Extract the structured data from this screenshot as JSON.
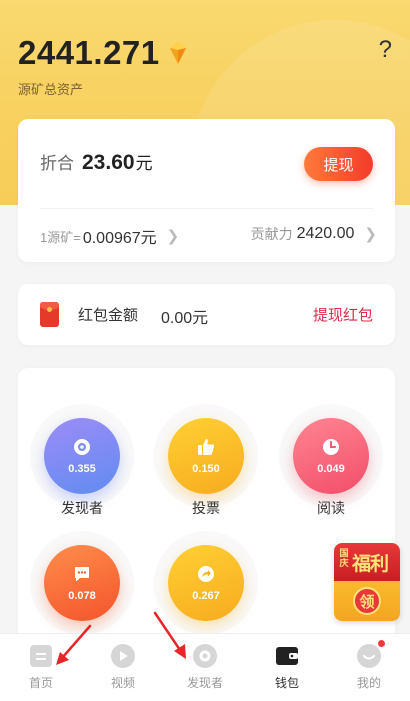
{
  "header": {
    "balance": "2441.271",
    "balance_label": "源矿总资产",
    "help": "?"
  },
  "summary": {
    "equiv_label": "折合",
    "equiv_value": "23.60",
    "equiv_unit": "元",
    "withdraw_label": "提现",
    "rate_label": "1源矿=",
    "rate_value": "0.00967元",
    "contribution_label": "贡献力",
    "contribution_value": "2420.00"
  },
  "red_packet": {
    "label": "红包金额",
    "value": "0.00元",
    "action": "提现红包"
  },
  "grid": [
    {
      "label": "发现者",
      "value": "0.355",
      "icon": "eye-icon"
    },
    {
      "label": "投票",
      "value": "0.150",
      "icon": "thumbs-up-icon"
    },
    {
      "label": "阅读",
      "value": "0.049",
      "icon": "clock-icon"
    },
    {
      "label": "",
      "value": "0.078",
      "icon": "chat-icon"
    },
    {
      "label": "",
      "value": "0.267",
      "icon": "share-icon"
    }
  ],
  "promo": {
    "small_text": "国庆",
    "big_text": "福利",
    "coin_text": "领"
  },
  "tabbar": [
    {
      "label": "首页",
      "icon": "home-icon"
    },
    {
      "label": "视频",
      "icon": "video-icon"
    },
    {
      "label": "发现者",
      "icon": "eye-icon"
    },
    {
      "label": "钱包",
      "icon": "wallet-icon"
    },
    {
      "label": "我的",
      "icon": "profile-icon"
    }
  ],
  "colors": {
    "accent_red": "#f43b2a",
    "link_red": "#e02a4a",
    "header_yellow": "#f8d05e"
  }
}
